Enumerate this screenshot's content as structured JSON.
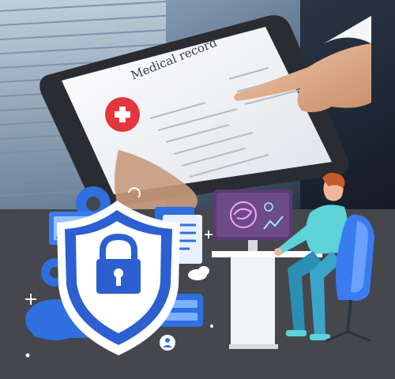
{
  "photo": {
    "tablet_title": "Medical record"
  },
  "icons": {
    "shield": "shield-lock-icon",
    "monitor": "brain-monitor-icon"
  },
  "colors": {
    "background": "#45474c",
    "accent_blue": "#2f6fe0",
    "shield_blue": "#2c5fd0",
    "monitor_purple": "#5a3b72",
    "red_badge": "#e2373d"
  }
}
